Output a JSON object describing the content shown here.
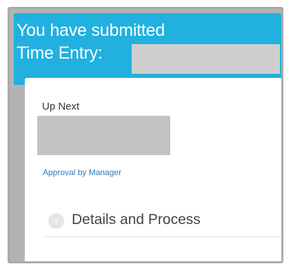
{
  "header": {
    "line1": "You have submitted",
    "line2": "Time Entry:"
  },
  "card": {
    "up_next_label": "Up Next",
    "approval_link": "Approval by Manager",
    "details_label": "Details and Process",
    "details_icon": "chevron-right-icon"
  },
  "colors": {
    "header_bg": "#21b0e0",
    "link": "#2f7ab8",
    "frame_bg": "#b3b3b3"
  }
}
